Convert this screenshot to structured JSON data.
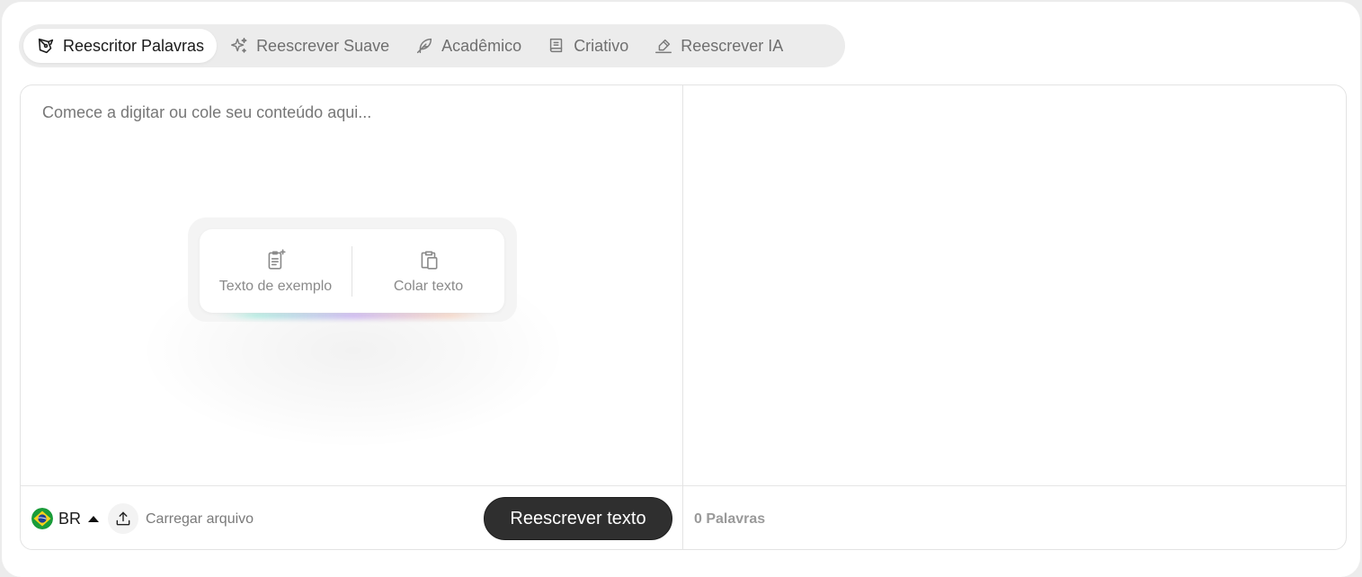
{
  "tabs": [
    {
      "label": "Reescritor Palavras",
      "icon": "pen-tool-icon",
      "active": true
    },
    {
      "label": "Reescrever Suave",
      "icon": "sparkles-icon",
      "active": false
    },
    {
      "label": "Acadêmico",
      "icon": "feather-icon",
      "active": false
    },
    {
      "label": "Criativo",
      "icon": "book-icon",
      "active": false
    },
    {
      "label": "Reescrever IA",
      "icon": "signature-icon",
      "active": false
    }
  ],
  "editor": {
    "placeholder": "Comece a digitar ou cole seu conteúdo aqui...",
    "quick_actions": {
      "sample_label": "Texto de exemplo",
      "paste_label": "Colar texto"
    },
    "language": {
      "code": "BR",
      "flag": "brazil-flag-icon"
    },
    "upload_label": "Carregar arquivo",
    "rewrite_button": "Reescrever texto"
  },
  "output": {
    "word_count": "0 Palavras"
  },
  "colors": {
    "primary_button": "#2f2f2f",
    "tab_bar": "#ececec",
    "muted_text": "#7a7a7a"
  }
}
